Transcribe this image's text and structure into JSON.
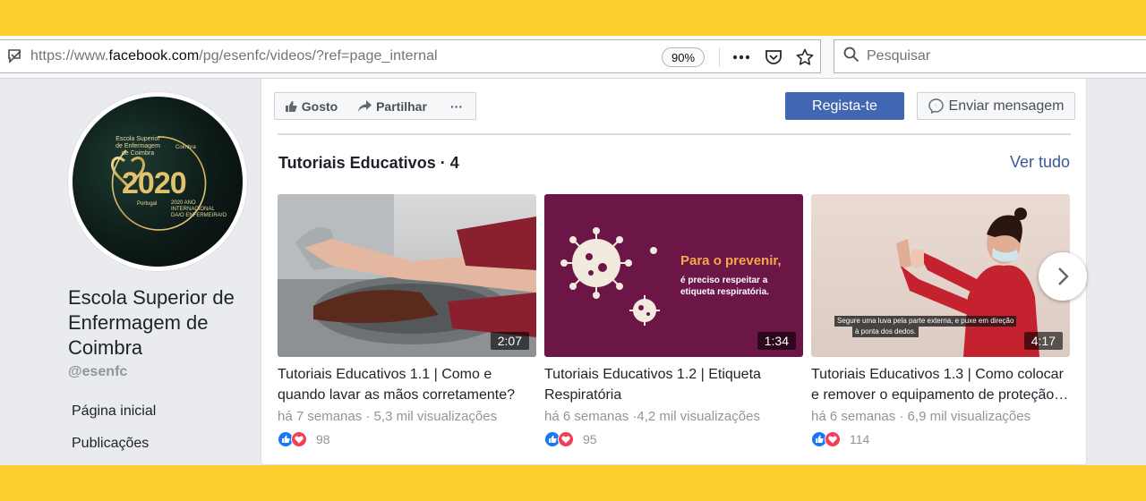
{
  "browser": {
    "url_prefix": "https://www.",
    "url_domain": "facebook.com",
    "url_path": "/pg/esenfc/videos/?ref=page_internal",
    "zoom": "90%",
    "search_placeholder": "Pesquisar"
  },
  "page": {
    "name": "Escola Superior de Enfermagem de Coimbra",
    "handle": "@esenfc",
    "logo_text": {
      "line1": "Escola Superior",
      "line2": "de Enfermagem",
      "line3": "de Coimbra",
      "year": "2020",
      "small_right": "Coimbra",
      "small_left": "Portugal",
      "caption1": "2020 ANO",
      "caption2": "INTERNACIONAL",
      "caption3": "DA/O ENFERMEIRA/O"
    },
    "nav": [
      "Página inicial",
      "Publicações"
    ]
  },
  "actions": {
    "like": "Gosto",
    "share": "Partilhar",
    "more": "···",
    "register": "Regista-te",
    "message": "Enviar mensagem"
  },
  "section": {
    "title": "Tutoriais Educativos · 4",
    "see_all": "Ver tudo"
  },
  "videos": [
    {
      "title": "Tutoriais Educativos 1.1 | Como e quando lavar as mãos corretamente?",
      "meta": "há 7 semanas · 5,3 mil visualizações",
      "duration": "2:07",
      "reactions": "98"
    },
    {
      "title": "Tutoriais Educativos 1.2 | Etiqueta Respiratória",
      "meta": "há 6 semanas ·4,2 mil visualizações",
      "duration": "1:34",
      "reactions": "95",
      "overlay_heading": "Para o prevenir,",
      "overlay_line1": "é preciso respeitar a",
      "overlay_line2": "etiqueta respiratória."
    },
    {
      "title": "Tutoriais Educativos 1.3 | Como colocar e remover o equipamento de proteção…",
      "meta": "há 6 semanas · 6,9 mil visualizações",
      "duration": "4:17",
      "reactions": "114",
      "subtitle_line1": "Segure uma luva pela parte externa, e puxe em direção",
      "subtitle_line2": "à ponta dos dedos."
    }
  ],
  "colors": {
    "frame": "#fdd02f",
    "fb_blue": "#4267b2",
    "link": "#385898",
    "video2_bg": "#6b1646",
    "video2_heading": "#f6a74b"
  }
}
